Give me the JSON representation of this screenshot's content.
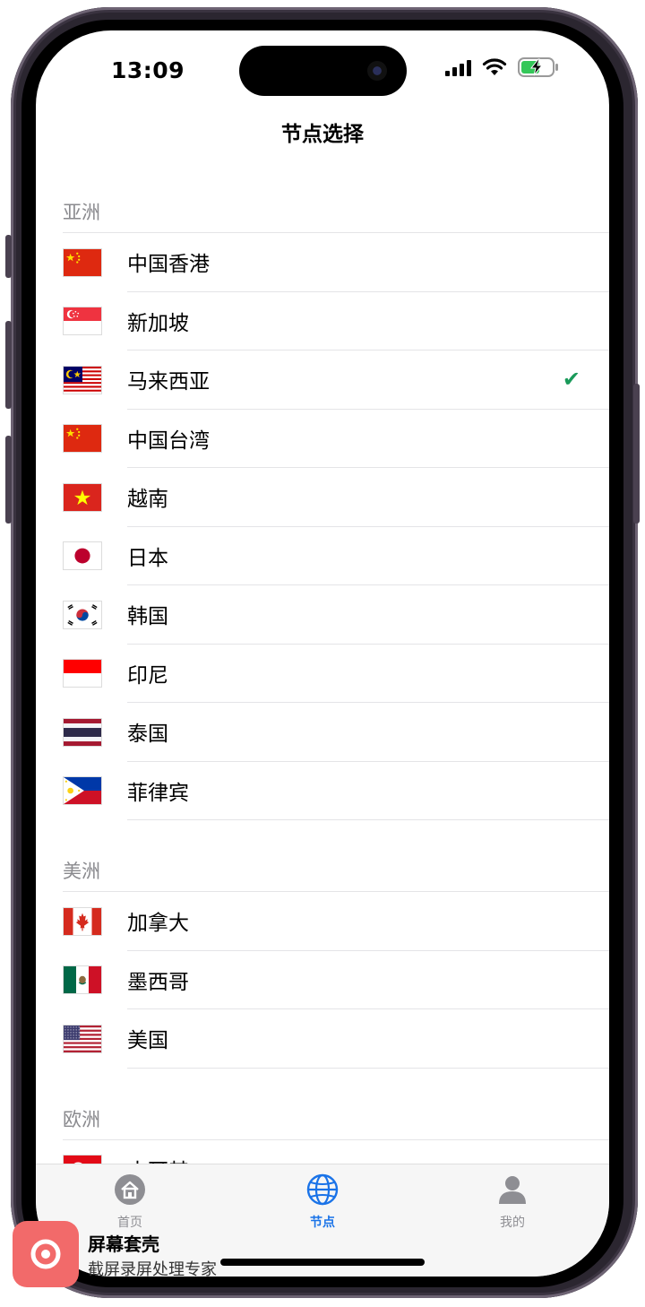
{
  "status_bar": {
    "time": "13:09"
  },
  "header": {
    "title": "节点选择"
  },
  "colors": {
    "accent": "#1a73e8",
    "check": "#1a9a5a",
    "section_text": "#8a8a8e",
    "tab_inactive": "#8e8e93"
  },
  "sections": [
    {
      "title": "亚洲",
      "items": [
        {
          "label": "中国香港",
          "flag": "flag-china",
          "selected": false
        },
        {
          "label": "新加坡",
          "flag": "flag-singapore",
          "selected": false
        },
        {
          "label": "马来西亚",
          "flag": "flag-malaysia",
          "selected": true
        },
        {
          "label": "中国台湾",
          "flag": "flag-china",
          "selected": false
        },
        {
          "label": "越南",
          "flag": "flag-vietnam",
          "selected": false
        },
        {
          "label": "日本",
          "flag": "flag-japan",
          "selected": false
        },
        {
          "label": "韩国",
          "flag": "flag-korea",
          "selected": false
        },
        {
          "label": "印尼",
          "flag": "flag-indonesia",
          "selected": false
        },
        {
          "label": "泰国",
          "flag": "flag-thailand",
          "selected": false
        },
        {
          "label": "菲律宾",
          "flag": "flag-philippines",
          "selected": false
        }
      ]
    },
    {
      "title": "美洲",
      "items": [
        {
          "label": "加拿大",
          "flag": "flag-canada",
          "selected": false
        },
        {
          "label": "墨西哥",
          "flag": "flag-mexico",
          "selected": false
        },
        {
          "label": "美国",
          "flag": "flag-usa",
          "selected": false
        }
      ]
    },
    {
      "title": "欧洲",
      "items": [
        {
          "label": "土耳其",
          "flag": "flag-turkey",
          "selected": false
        }
      ]
    }
  ],
  "check_mark": "✔",
  "tabbar": {
    "tabs": [
      {
        "label": "首页",
        "icon": "home-icon",
        "active": false
      },
      {
        "label": "节点",
        "icon": "globe-icon",
        "active": true
      },
      {
        "label": "我的",
        "icon": "person-icon",
        "active": false
      }
    ]
  },
  "watermark": {
    "title": "屏幕套壳",
    "subtitle": "截屏录屏处理专家"
  }
}
